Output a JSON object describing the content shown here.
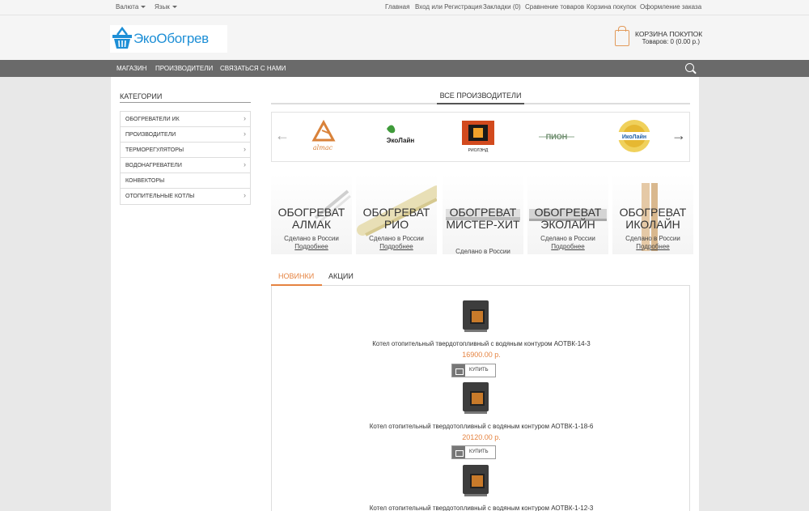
{
  "topbar": {
    "currency": "Валюта",
    "language": "Язык",
    "links": [
      "Главная",
      "Вход или Регистрация",
      "Закладки (0)",
      "Сравнение товаров",
      "Корзина покупок",
      "Оформление заказа"
    ]
  },
  "header": {
    "logo_text": "ЭкоОбогрев",
    "cart_title": "КОРЗИНА ПОКУПОК",
    "cart_summary": "Товаров: 0 (0.00 р.)"
  },
  "nav": {
    "items": [
      "МАГАЗИН",
      "ПРОИЗВОДИТЕЛИ",
      "СВЯЗАТЬСЯ С НАМИ"
    ]
  },
  "sidebar": {
    "title": "КАТЕГОРИИ",
    "items": [
      "ОБОГРЕВАТЕЛИ ИК",
      "ПРОИЗВОДИТЕЛИ",
      "ТЕРМОРЕГУЛЯТОРЫ",
      "ВОДОНАГРЕВАТЕЛИ",
      "КОНВЕКТОРЫ",
      "ОТОПИТЕЛЬНЫЕ КОТЛЫ"
    ]
  },
  "manufacturers": {
    "title": "ВСЕ ПРОИЗВОДИТЕЛИ",
    "brands": [
      "almac",
      "ЭкоЛайн",
      "РИОЛЭНД",
      "ПИОН",
      "ИкоЛайн"
    ]
  },
  "banners": [
    {
      "title": "ОБОГРЕВАТ АЛМАК",
      "sub": "Сделано в России",
      "more": "Подробнее"
    },
    {
      "title": "ОБОГРЕВАТ РИО",
      "sub": "Сделано в России",
      "more": "Подробнее"
    },
    {
      "title": "ОБОГРЕВАТ МИСТЕР-ХИТ",
      "sub": "Сделано в России",
      "more": ""
    },
    {
      "title": "ОБОГРЕВАТ ЭКОЛАЙН",
      "sub": "Сделано в России",
      "more": "Подробнее"
    },
    {
      "title": "ОБОГРЕВАТ ИКОЛАЙН",
      "sub": "Сделано в России",
      "more": "Подробнее"
    }
  ],
  "tabs": [
    "НОВИНКИ",
    "АКЦИИ"
  ],
  "products": [
    {
      "name": "Котел отопительный твердотопливный с водяным контуром АОТВК-14-3",
      "price": "16900.00 р.",
      "buy": "КУПИТЬ"
    },
    {
      "name": "Котел отопительный твердотопливный с водяным контуром АОТВК-1-18-6",
      "price": "20120.00 р.",
      "buy": "КУПИТЬ"
    },
    {
      "name": "Котел отопительный твердотопливный с водяным контуром АОТВК-1-12-3",
      "price": "",
      "buy": ""
    }
  ],
  "colors": {
    "accent": "#e58340",
    "nav": "#6a6a6a",
    "logo": "#1e8fd6"
  }
}
